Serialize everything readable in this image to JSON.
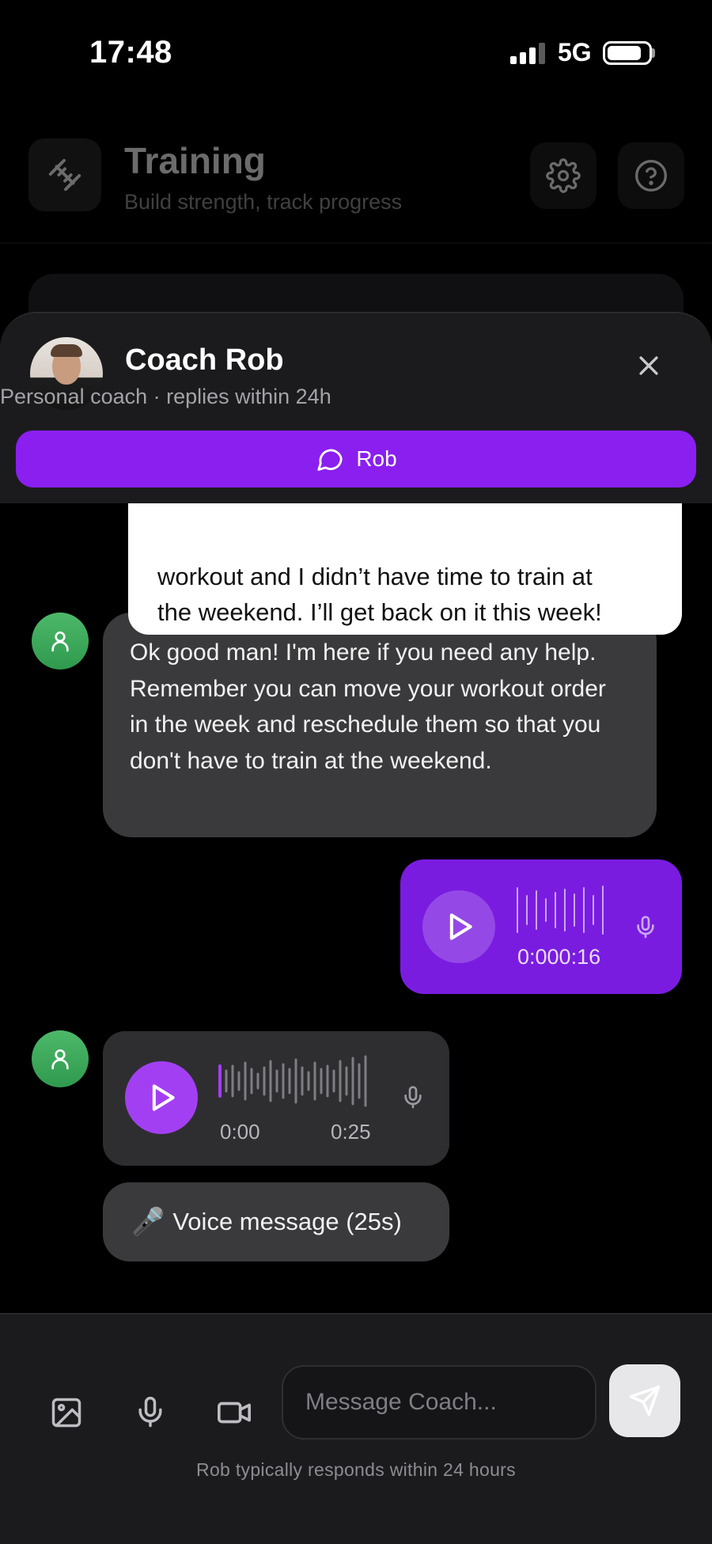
{
  "status_bar": {
    "time": "17:48",
    "network": "5G"
  },
  "background_header": {
    "title": "Training",
    "subtitle": "Build strength, track progress"
  },
  "chat_header": {
    "coach_name": "Coach Rob",
    "coach_subtitle": "Personal coach · replies within 24h",
    "tab_label": "Rob"
  },
  "messages": {
    "outgoing_text": {
      "line1": "workout and I didn’t have time to train at",
      "line2": "the weekend. I’ll get back on it this week!"
    },
    "incoming_text": "Ok good man! I'm here if you need any help. Remember you can move your workout order in the week and reschedule them so that you don't have to train at the weekend.",
    "outgoing_voice": {
      "time": "0:000:16"
    },
    "incoming_voice": {
      "start": "0:00",
      "end": "0:25",
      "progress": 0
    },
    "voice_label": {
      "emoji": "🎤",
      "text": "Voice message (25s)"
    }
  },
  "composer": {
    "placeholder": "Message Coach...",
    "hint": "Rob typically responds within 24 hours"
  },
  "colors": {
    "accent": "#8a1ff0",
    "outgoing_voice_bg": "#7a1ce0",
    "incoming_bubble": "#3a3a3d",
    "coach_avatar": "#3fa95c"
  },
  "icons": [
    "dumbbell-icon",
    "gear-icon",
    "help-icon",
    "close-icon",
    "chat-bubble-icon",
    "user-icon",
    "play-icon",
    "mic-icon",
    "image-icon",
    "video-icon",
    "send-icon"
  ]
}
